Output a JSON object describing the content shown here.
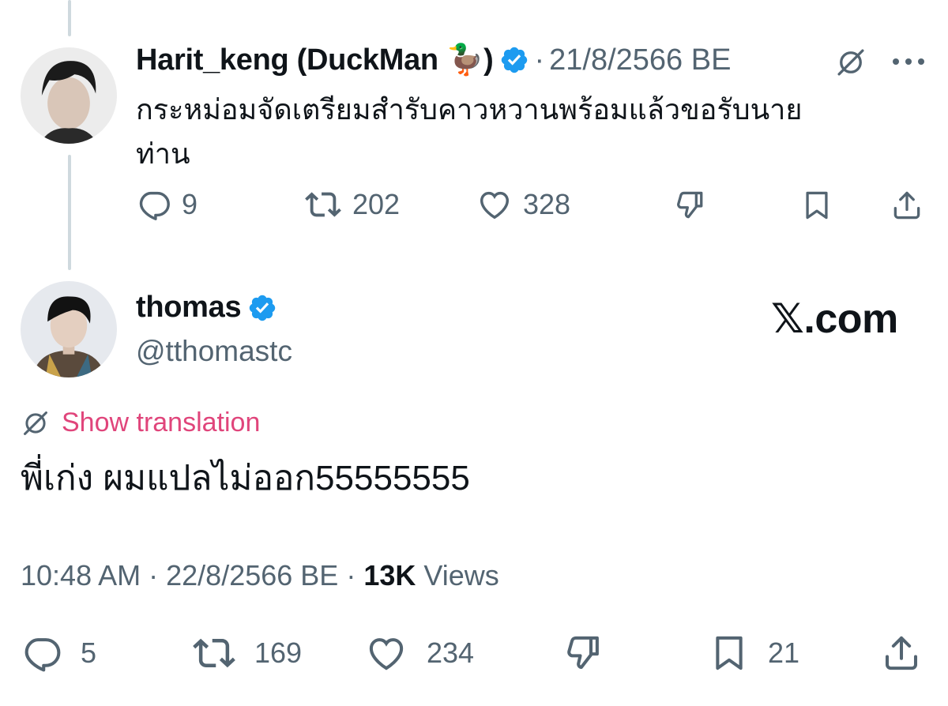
{
  "tweet_parent": {
    "display_name": "Harit_keng (DuckMan 🦆)",
    "separator": "·",
    "date": "21/8/2566 BE",
    "text_line1": "กระหม่อมจัดเตรียมสำรับคาวหวานพร้อมแล้วขอรับนาย",
    "text_line2": "ท่าน",
    "stats": {
      "replies": "9",
      "reposts": "202",
      "likes": "328"
    }
  },
  "tweet_main": {
    "display_name": "thomas",
    "handle": "@tthomastc",
    "watermark": "𝕏.com",
    "show_translation": "Show translation",
    "text": "พี่เก่ง ผมแปลไม่ออก55555555",
    "time": "10:48 AM",
    "date": "22/8/2566 BE",
    "views_count": "13K",
    "views_label": "Views",
    "sep": "·",
    "stats": {
      "replies": "5",
      "reposts": "169",
      "likes": "234",
      "bookmarks": "21"
    }
  },
  "colors": {
    "verified": "#1d9bf0",
    "accent_pink": "#e0457b",
    "muted": "#536471"
  }
}
